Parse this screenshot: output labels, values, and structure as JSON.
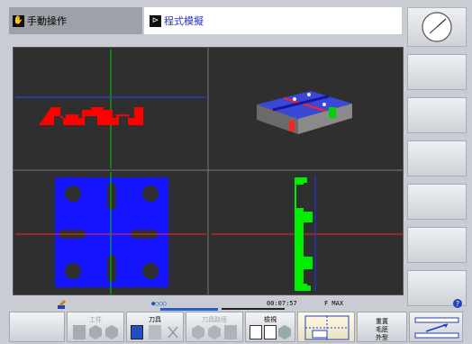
{
  "header": {
    "mode_left": "手動操作",
    "mode_right": "程式模擬"
  },
  "status": {
    "dots": "●○○○",
    "time": "00:07:57",
    "feed": "F MAX"
  },
  "softkeys": {
    "workpiece": "工件",
    "tool": "刀具",
    "tool_path": "刀具路徑",
    "view": "檢視",
    "reset_line1": "重置",
    "reset_line2": "毛胚",
    "reset_line3": "外型"
  },
  "colors": {
    "background": "#2f2f2f",
    "material": "#1414ff",
    "profile": "#ff0000",
    "side_profile": "#00ee00",
    "axis_green": "#00cc00",
    "axis_red": "#ff2020",
    "accent_blue": "#2a35c8"
  },
  "icons": {
    "hand": "hand-icon",
    "program": "program-run-icon",
    "clock": "clock-icon",
    "help": "help-icon"
  }
}
